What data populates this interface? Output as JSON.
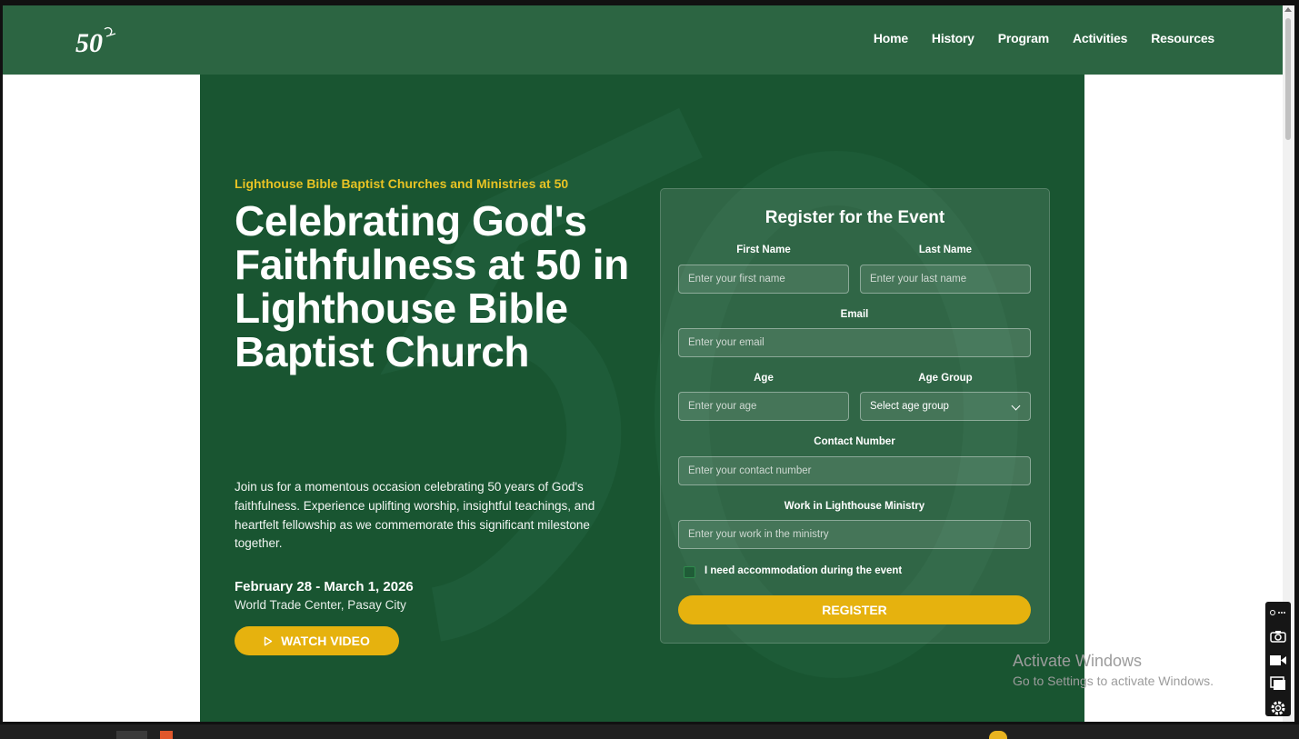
{
  "brand": {
    "logo_text": "50"
  },
  "nav": {
    "items": [
      "Home",
      "History",
      "Program",
      "Activities",
      "Resources"
    ]
  },
  "hero": {
    "eyebrow": "Lighthouse Bible Baptist Churches and Ministries at 50",
    "headline": "Celebrating God's Faithfulness at 50 in Lighthouse Bible Baptist Church",
    "description": "Join us for a momentous occasion celebrating 50 years of God's faithfulness. Experience uplifting worship, insightful teachings, and heartfelt fellowship as we commemorate this significant milestone together.",
    "date": "February 28 - March 1, 2026",
    "venue": "World Trade Center, Pasay City",
    "watch_label": "WATCH VIDEO"
  },
  "form": {
    "title": "Register for the Event",
    "first_name": {
      "label": "First Name",
      "placeholder": "Enter your first name"
    },
    "last_name": {
      "label": "Last Name",
      "placeholder": "Enter your last name"
    },
    "email": {
      "label": "Email",
      "placeholder": "Enter your email"
    },
    "age": {
      "label": "Age",
      "placeholder": "Enter your age"
    },
    "age_group": {
      "label": "Age Group",
      "selected": "Select age group"
    },
    "contact": {
      "label": "Contact Number",
      "placeholder": "Enter your contact number"
    },
    "work": {
      "label": "Work in Lighthouse Ministry",
      "placeholder": "Enter your work in the ministry"
    },
    "accommodation_label": "I need accommodation during the event",
    "accommodation_checked": false,
    "register_label": "REGISTER"
  },
  "os": {
    "activate_title": "Activate Windows",
    "activate_sub": "Go to Settings to activate Windows."
  },
  "colors": {
    "brand_green": "#2c6542",
    "hero_green": "#195531",
    "accent_yellow": "#e6b20e",
    "eyebrow_yellow": "#e8c324"
  }
}
